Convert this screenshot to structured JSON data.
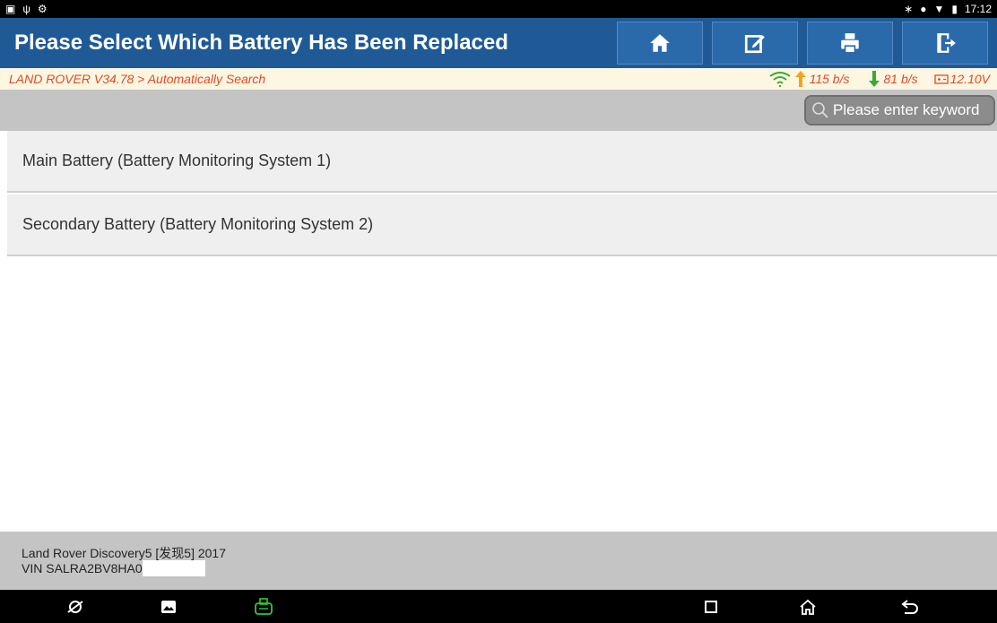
{
  "status_bar": {
    "time": "17:12"
  },
  "header": {
    "title": "Please Select Which Battery Has Been Replaced",
    "buttons": [
      "home-icon",
      "edit-icon",
      "print-icon",
      "exit-icon"
    ]
  },
  "info_bar": {
    "breadcrumb": "LAND ROVER V34.78 > Automatically Search",
    "upload_speed": "115 b/s",
    "download_speed": "81 b/s",
    "voltage": "12.10V"
  },
  "search": {
    "placeholder": "Please enter keyword"
  },
  "battery_list": {
    "items": [
      {
        "label": "Main Battery (Battery Monitoring System 1)"
      },
      {
        "label": "Secondary Battery (Battery Monitoring System 2)"
      }
    ]
  },
  "footer": {
    "vehicle": "Land Rover Discovery5 [发现5] 2017",
    "vin": "VIN SALRA2BV8HA0"
  },
  "colors": {
    "title_bar": "#1f5a96",
    "info_text": "#e0492a",
    "upload_arrow": "#f7a21b",
    "download_arrow": "#3aa83a",
    "wifi": "#3aa83a"
  }
}
